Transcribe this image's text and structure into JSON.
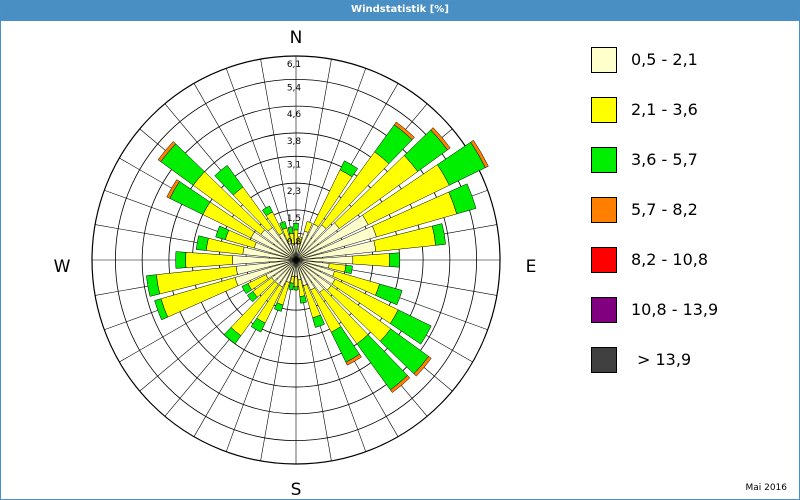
{
  "header": {
    "title": "Windstatistik [%]"
  },
  "footer": {
    "date": "Mai 2016"
  },
  "compass": {
    "n": "N",
    "e": "E",
    "s": "S",
    "w": "W"
  },
  "chart_data": {
    "type": "windrose",
    "title": "Windstatistik [%]",
    "rmax": 6.1,
    "ring_labels": [
      "0,8",
      "1,5",
      "2,3",
      "3,1",
      "3,8",
      "4,6",
      "5,4",
      "6,1"
    ],
    "ring_values": [
      0.8,
      1.5,
      2.3,
      3.1,
      3.8,
      4.6,
      5.4,
      6.1
    ],
    "direction_step_deg": 10,
    "sector_width_deg": 8,
    "legend": [
      {
        "label": "0,5 - 2,1",
        "color": "#ffffcc"
      },
      {
        "label": "2,1 - 3,6",
        "color": "#ffff00"
      },
      {
        "label": "3,6 - 5,7",
        "color": "#00ee00"
      },
      {
        "label": "5,7 - 8,2",
        "color": "#ff8000"
      },
      {
        "label": "8,2 - 10,8",
        "color": "#ff0000"
      },
      {
        "label": "10,8 - 13,9",
        "color": "#800080"
      },
      {
        "label": "> 13,9",
        "color": "#404040"
      }
    ],
    "sectors": [
      {
        "dir": 0,
        "values": [
          0.5,
          0.4,
          0.2,
          0,
          0,
          0,
          0
        ]
      },
      {
        "dir": 10,
        "values": [
          0.5,
          0.2,
          0,
          0,
          0,
          0,
          0
        ]
      },
      {
        "dir": 20,
        "values": [
          0.9,
          0.3,
          0,
          0,
          0,
          0,
          0
        ]
      },
      {
        "dir": 30,
        "values": [
          1.2,
          1.8,
          0.3,
          0,
          0,
          0,
          0
        ]
      },
      {
        "dir": 40,
        "values": [
          1.3,
          2.7,
          1.0,
          0.1,
          0,
          0,
          0
        ]
      },
      {
        "dir": 50,
        "values": [
          1.6,
          2.9,
          1.1,
          0.1,
          0,
          0,
          0
        ]
      },
      {
        "dir": 60,
        "values": [
          2.4,
          2.7,
          1.2,
          0.1,
          0,
          0,
          0
        ]
      },
      {
        "dir": 70,
        "values": [
          2.5,
          2.5,
          0.6,
          0,
          0,
          0,
          0
        ]
      },
      {
        "dir": 80,
        "values": [
          2.4,
          1.8,
          0.3,
          0,
          0,
          0,
          0
        ]
      },
      {
        "dir": 90,
        "values": [
          1.7,
          1.1,
          0.3,
          0,
          0,
          0,
          0
        ]
      },
      {
        "dir": 100,
        "values": [
          1.0,
          0.5,
          0.2,
          0,
          0,
          0,
          0
        ]
      },
      {
        "dir": 110,
        "values": [
          1.2,
          1.4,
          0.7,
          0,
          0,
          0,
          0
        ]
      },
      {
        "dir": 120,
        "values": [
          1.3,
          2.1,
          1.1,
          0,
          0,
          0,
          0
        ]
      },
      {
        "dir": 130,
        "values": [
          1.3,
          2.2,
          1.4,
          0.1,
          0,
          0,
          0
        ]
      },
      {
        "dir": 140,
        "values": [
          1.2,
          1.9,
          1.7,
          0.1,
          0,
          0,
          0
        ]
      },
      {
        "dir": 150,
        "values": [
          1.0,
          1.4,
          1.0,
          0.1,
          0,
          0,
          0
        ]
      },
      {
        "dir": 160,
        "values": [
          0.8,
          1.0,
          0.3,
          0,
          0,
          0,
          0
        ]
      },
      {
        "dir": 170,
        "values": [
          0.6,
          0.5,
          0.2,
          0,
          0,
          0,
          0
        ]
      },
      {
        "dir": 180,
        "values": [
          0.5,
          0.3,
          0.1,
          0,
          0,
          0,
          0
        ]
      },
      {
        "dir": 190,
        "values": [
          0.5,
          0.2,
          0.2,
          0,
          0,
          0,
          0
        ]
      },
      {
        "dir": 200,
        "values": [
          0.7,
          0.7,
          0.2,
          0,
          0,
          0,
          0
        ]
      },
      {
        "dir": 210,
        "values": [
          0.9,
          1.2,
          0.3,
          0,
          0,
          0,
          0
        ]
      },
      {
        "dir": 220,
        "values": [
          0.9,
          1.9,
          0.3,
          0,
          0,
          0,
          0
        ]
      },
      {
        "dir": 230,
        "values": [
          0.9,
          0.7,
          0.2,
          0,
          0,
          0,
          0
        ]
      },
      {
        "dir": 240,
        "values": [
          1.0,
          0.6,
          0.2,
          0,
          0,
          0,
          0
        ]
      },
      {
        "dir": 250,
        "values": [
          1.9,
          2.3,
          0.2,
          0,
          0,
          0,
          0
        ]
      },
      {
        "dir": 260,
        "values": [
          1.8,
          2.4,
          0.3,
          0,
          0,
          0,
          0
        ]
      },
      {
        "dir": 270,
        "values": [
          1.9,
          1.4,
          0.3,
          0,
          0,
          0,
          0
        ]
      },
      {
        "dir": 280,
        "values": [
          1.6,
          1.1,
          0.3,
          0,
          0,
          0,
          0
        ]
      },
      {
        "dir": 290,
        "values": [
          1.3,
          0.9,
          0.3,
          0,
          0,
          0,
          0
        ]
      },
      {
        "dir": 300,
        "values": [
          1.5,
          1.6,
          1.1,
          0.1,
          0,
          0,
          0
        ]
      },
      {
        "dir": 310,
        "values": [
          1.3,
          2.5,
          1.2,
          0.1,
          0,
          0,
          0
        ]
      },
      {
        "dir": 320,
        "values": [
          1.2,
          1.5,
          0.8,
          0,
          0,
          0,
          0
        ]
      },
      {
        "dir": 330,
        "values": [
          0.9,
          0.7,
          0.2,
          0,
          0,
          0,
          0
        ]
      },
      {
        "dir": 340,
        "values": [
          0.6,
          0.4,
          0.2,
          0,
          0,
          0,
          0
        ]
      },
      {
        "dir": 350,
        "values": [
          0.5,
          0.3,
          0.2,
          0,
          0,
          0,
          0
        ]
      }
    ]
  }
}
